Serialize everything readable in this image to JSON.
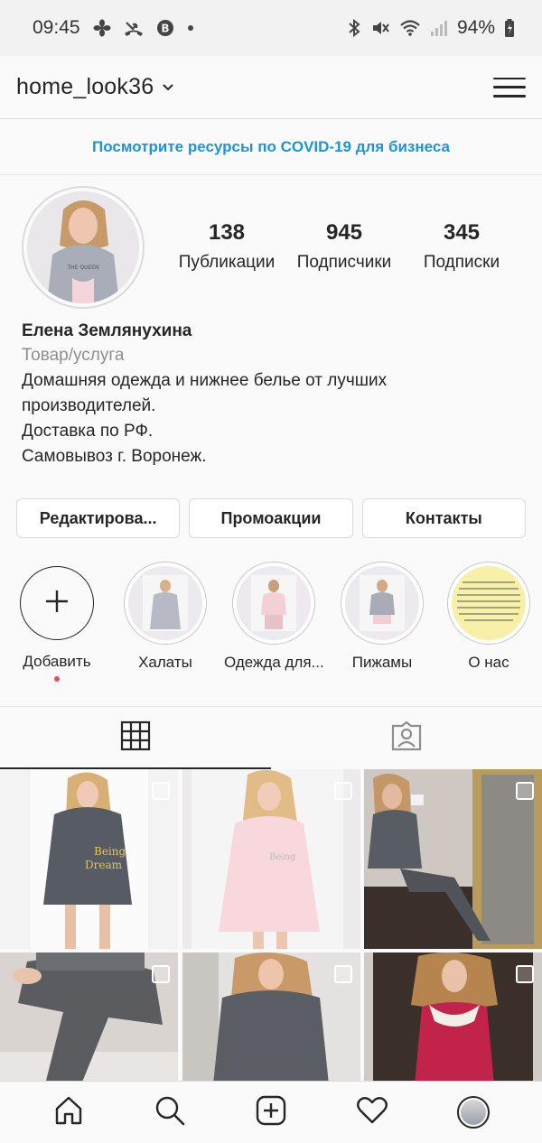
{
  "status_bar": {
    "time": "09:45",
    "battery": "94%"
  },
  "header": {
    "username": "home_look36"
  },
  "banner": {
    "text": "Посмотрите ресурсы по COVID-19 для бизнеса",
    "color": "#1b95d8"
  },
  "profile": {
    "stats": [
      {
        "value": "138",
        "label": "Публикации"
      },
      {
        "value": "945",
        "label": "Подписчики"
      },
      {
        "value": "345",
        "label": "Подписки"
      }
    ],
    "full_name": "Елена Землянухина",
    "category": "Товар/услуга",
    "bio_lines": [
      "Домашняя одежда и нижнее белье от лучших",
      "производителей.",
      "Доставка по РФ.",
      "Самовывоз г. Воронеж."
    ]
  },
  "actions": [
    {
      "label": "Редактирова..."
    },
    {
      "label": "Промоакции"
    },
    {
      "label": "Контакты"
    }
  ],
  "highlights": [
    {
      "label": "Добавить",
      "icon": "plus-icon"
    },
    {
      "label": "Халаты"
    },
    {
      "label": "Одежда для..."
    },
    {
      "label": "Пижамы"
    },
    {
      "label": "О нас"
    }
  ],
  "tabs": [
    {
      "icon": "grid-icon",
      "active": true
    },
    {
      "icon": "tagged-icon",
      "active": false
    }
  ],
  "bottom_nav": [
    {
      "icon": "home-icon"
    },
    {
      "icon": "search-icon"
    },
    {
      "icon": "new-post-icon"
    },
    {
      "icon": "heart-icon"
    },
    {
      "icon": "profile-avatar"
    }
  ]
}
